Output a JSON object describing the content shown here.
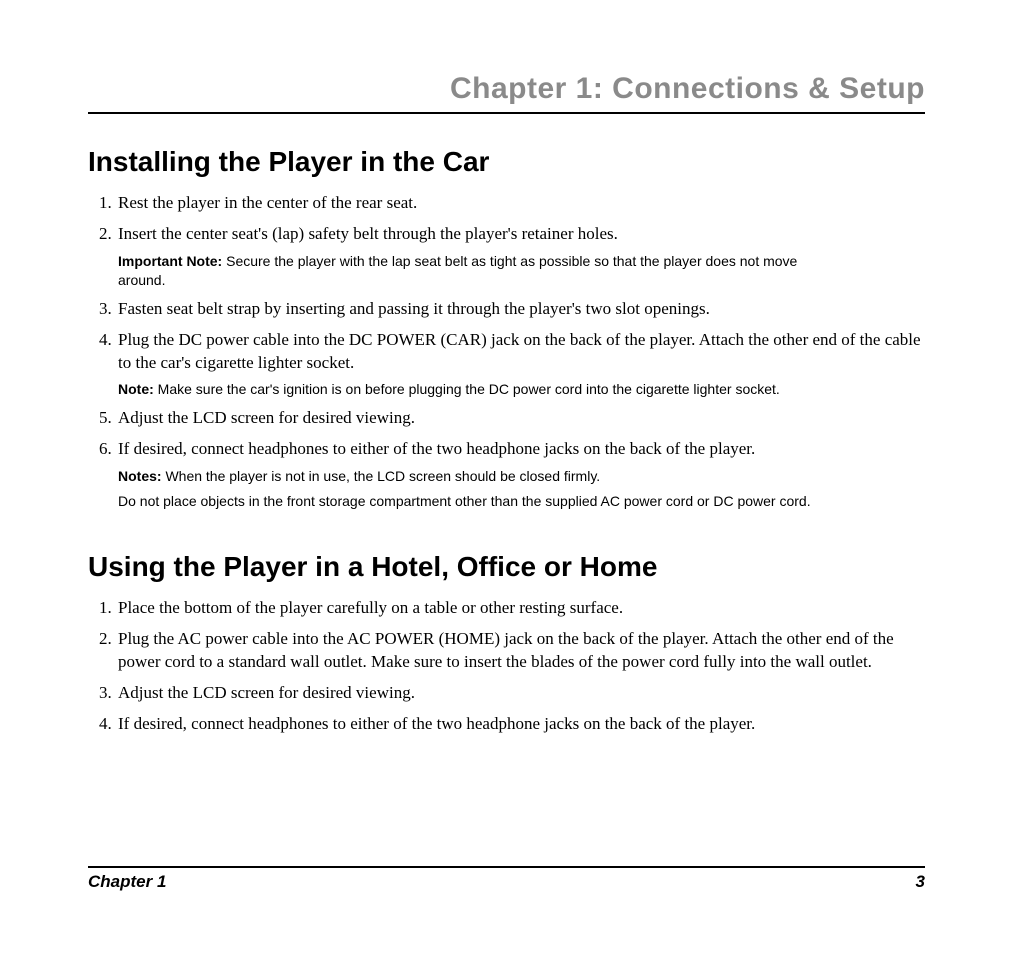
{
  "header": {
    "chapter_title": "Chapter 1: Connections & Setup"
  },
  "section1": {
    "title": "Installing the Player in the Car",
    "steps": {
      "s1": "Rest the player in the center of the rear seat.",
      "s2": "Insert the center seat's (lap) safety belt through the player's retainer holes.",
      "s2_note_label": "Important Note:",
      "s2_note": " Secure the player with the lap seat belt as tight as possible so that the player does not move around.",
      "s3": "Fasten seat belt strap by inserting and passing it through the player's two slot openings.",
      "s4": "Plug the DC power cable into the DC POWER (CAR) jack on the back of the player. Attach the other end of the cable to the car's cigarette lighter socket.",
      "s4_note_label": "Note:",
      "s4_note": " Make sure the car's ignition is on before plugging the DC power cord into the cigarette lighter socket.",
      "s5": "Adjust the LCD screen for desired viewing.",
      "s6": "If desired, connect headphones to either of the two headphone jacks on the back of the player.",
      "s6_note_label": "Notes:",
      "s6_note": " When the player is not in use, the LCD screen should be closed firmly.",
      "s6_note2": "Do not place objects in the front storage compartment other than the supplied AC power cord or DC power cord."
    }
  },
  "section2": {
    "title": "Using the Player in a Hotel, Office or Home",
    "steps": {
      "s1": "Place the bottom of the player carefully on a table or other resting surface.",
      "s2": "Plug the AC power cable into the AC POWER (HOME) jack on the back of the player. Attach the other end of the power cord to a standard wall outlet. Make sure to insert the blades of the power cord fully into the wall outlet.",
      "s3": "Adjust the LCD screen for desired viewing.",
      "s4": "If desired, connect headphones to either of the two headphone jacks on the back of the player."
    }
  },
  "footer": {
    "left": "Chapter 1",
    "right": "3"
  }
}
